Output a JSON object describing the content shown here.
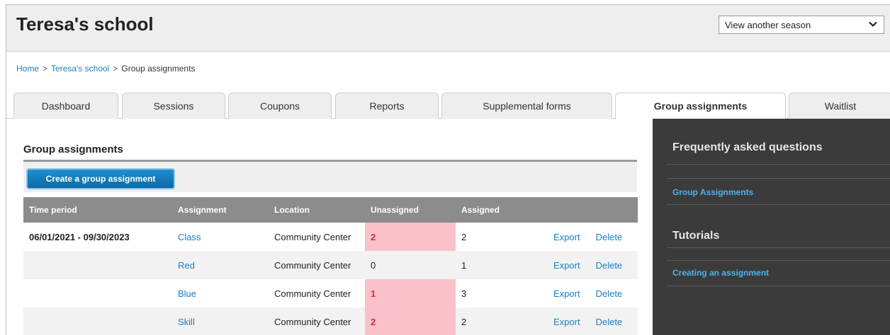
{
  "header": {
    "school_name": "Teresa's school",
    "season_select": {
      "selected": "View another season"
    }
  },
  "breadcrumb": {
    "items": [
      "Home",
      "Teresa's school",
      "Group assignments"
    ],
    "separator": ">"
  },
  "tabs": [
    {
      "label": "Dashboard",
      "active": false
    },
    {
      "label": "Sessions",
      "active": false
    },
    {
      "label": "Coupons",
      "active": false
    },
    {
      "label": "Reports",
      "active": false
    },
    {
      "label": "Supplemental forms",
      "active": false
    },
    {
      "label": "Group assignments",
      "active": true
    },
    {
      "label": "Waitlist",
      "active": false
    }
  ],
  "main": {
    "section_title": "Group assignments",
    "create_button_label": "Create a group assignment",
    "table": {
      "columns": [
        "Time period",
        "Assignment",
        "Location",
        "Unassigned",
        "Assigned",
        ""
      ],
      "rows": [
        {
          "time_period": "06/01/2021 - 09/30/2023",
          "assignment": "Class",
          "location": "Community Center",
          "unassigned": "2",
          "assigned": "2",
          "export": "Export",
          "delete": "Delete"
        },
        {
          "time_period": "",
          "assignment": "Red",
          "location": "Community Center",
          "unassigned": "0",
          "assigned": "1",
          "export": "Export",
          "delete": "Delete"
        },
        {
          "time_period": "",
          "assignment": "Blue",
          "location": "Community Center",
          "unassigned": "1",
          "assigned": "3",
          "export": "Export",
          "delete": "Delete"
        },
        {
          "time_period": "",
          "assignment": "Skill",
          "location": "Community Center",
          "unassigned": "2",
          "assigned": "2",
          "export": "Export",
          "delete": "Delete"
        }
      ]
    }
  },
  "sidebar": {
    "faq_heading": "Frequently asked questions",
    "faq_link": "Group Assignments",
    "tutorials_heading": "Tutorials",
    "tutorials_link": "Creating an assignment"
  },
  "colors": {
    "accent_blue": "#1a7fc1",
    "button_blue": "#1478bb",
    "header_gray": "#8c8c8c",
    "alert_pink": "#f9c2cb",
    "alert_red": "#e8262d",
    "sidebar_dark": "#3b3b3b",
    "sidebar_link": "#4db3ef"
  },
  "icons": {
    "season_chevron": "chevron-down-icon"
  }
}
